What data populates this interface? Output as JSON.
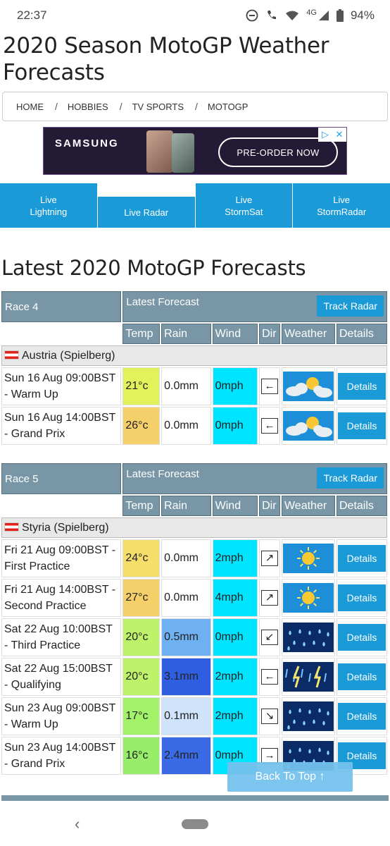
{
  "status": {
    "time": "22:37",
    "network": "4G",
    "battery": "94%"
  },
  "page_title": "2020 Season MotoGP Weather Forecasts",
  "breadcrumb": [
    "HOME",
    "HOBBIES",
    "TV SPORTS",
    "MOTOGP"
  ],
  "ad": {
    "brand": "SAMSUNG",
    "cta": "PRE-ORDER NOW"
  },
  "radar_tabs": [
    {
      "line1": "Live",
      "line2": "Lightning"
    },
    {
      "line1": "",
      "line2": "Live Radar"
    },
    {
      "line1": "Live",
      "line2": "StormSat"
    },
    {
      "line1": "Live",
      "line2": "StormRadar"
    }
  ],
  "section_title": "Latest 2020 MotoGP Forecasts",
  "columns": [
    "Temp",
    "Rain",
    "Wind",
    "Dir",
    "Weather",
    "Details"
  ],
  "latest_forecast_label": "Latest Forecast",
  "track_radar_label": "Track Radar",
  "details_label": "Details",
  "back_to_top": "Back To Top ↑",
  "races": [
    {
      "name": "Race 4",
      "venue": "Austria (Spielberg)",
      "rows": [
        {
          "when": "Sun 16 Aug 09:00BST",
          "session": "- Warm Up",
          "temp": "21°c",
          "temp_color": "#e2f25a",
          "rain": "0.0mm",
          "rain_color": "#ffffff",
          "wind": "0mph",
          "dir": "←",
          "weather": "partly-cloudy-sun"
        },
        {
          "when": "Sun 16 Aug 14:00BST",
          "session": "- Grand Prix",
          "temp": "26°c",
          "temp_color": "#f5cf6a",
          "rain": "0.0mm",
          "rain_color": "#ffffff",
          "wind": "0mph",
          "dir": "←",
          "weather": "partly-cloudy-sun"
        }
      ]
    },
    {
      "name": "Race 5",
      "venue": "Styria (Spielberg)",
      "rows": [
        {
          "when": "Fri 21 Aug 09:00BST -",
          "session": "First Practice",
          "temp": "24°c",
          "temp_color": "#f5de6a",
          "rain": "0.0mm",
          "rain_color": "#ffffff",
          "wind": "2mph",
          "dir": "↗",
          "weather": "sunny"
        },
        {
          "when": "Fri 21 Aug 14:00BST -",
          "session": "Second Practice",
          "temp": "27°c",
          "temp_color": "#f5cf6a",
          "rain": "0.0mm",
          "rain_color": "#ffffff",
          "wind": "4mph",
          "dir": "↗",
          "weather": "sunny"
        },
        {
          "when": "Sat 22 Aug 10:00BST",
          "session": "- Third Practice",
          "temp": "20°c",
          "temp_color": "#bdf26a",
          "rain": "0.5mm",
          "rain_color": "#6fb0f2",
          "wind": "0mph",
          "dir": "↙",
          "weather": "rain"
        },
        {
          "when": "Sat 22 Aug 15:00BST",
          "session": "- Qualifying",
          "temp": "20°c",
          "temp_color": "#bdf26a",
          "rain": "3.1mm",
          "rain_color": "#2f5fe0",
          "wind": "2mph",
          "dir": "←",
          "weather": "thunderstorm"
        },
        {
          "when": "Sun 23 Aug 09:00BST",
          "session": "- Warm Up",
          "temp": "17°c",
          "temp_color": "#a2f26a",
          "rain": "0.1mm",
          "rain_color": "#cfe4fb",
          "wind": "2mph",
          "dir": "↘",
          "weather": "rain"
        },
        {
          "when": "Sun 23 Aug 14:00BST",
          "session": "- Grand Prix",
          "temp": "16°c",
          "temp_color": "#98ee6a",
          "rain": "2.4mm",
          "rain_color": "#3a6ae6",
          "wind": "0mph",
          "dir": "→",
          "weather": "rain"
        }
      ]
    }
  ]
}
